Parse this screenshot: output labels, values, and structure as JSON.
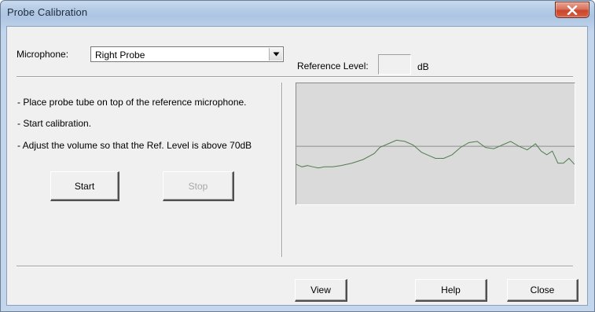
{
  "window": {
    "title": "Probe Calibration"
  },
  "microphone": {
    "label": "Microphone:",
    "selected": "Right Probe"
  },
  "instructions": [
    "- Place probe tube on top of the reference microphone.",
    "- Start calibration.",
    "- Adjust the volume so that the Ref. Level is above 70dB"
  ],
  "buttons": {
    "start": "Start",
    "stop": "Stop",
    "view": "View",
    "help": "Help",
    "close": "Close"
  },
  "reference": {
    "label": "Reference Level:",
    "value": "",
    "unit": "dB"
  },
  "colors": {
    "trace": "#4f7d4f",
    "reference_line": "#8e8e8e",
    "plot_background": "#dadada"
  },
  "chart_data": {
    "type": "line",
    "x": [
      0,
      0.02,
      0.04,
      0.06,
      0.08,
      0.1,
      0.13,
      0.16,
      0.2,
      0.24,
      0.28,
      0.3,
      0.33,
      0.36,
      0.39,
      0.42,
      0.45,
      0.48,
      0.5,
      0.53,
      0.56,
      0.59,
      0.62,
      0.65,
      0.68,
      0.71,
      0.74,
      0.77,
      0.8,
      0.83,
      0.86,
      0.88,
      0.9,
      0.92,
      0.94,
      0.96,
      0.98,
      1.0
    ],
    "series": [
      {
        "values": [
          0.33,
          0.31,
          0.32,
          0.31,
          0.3,
          0.31,
          0.31,
          0.32,
          0.34,
          0.37,
          0.42,
          0.47,
          0.5,
          0.53,
          0.52,
          0.49,
          0.43,
          0.4,
          0.38,
          0.38,
          0.41,
          0.47,
          0.51,
          0.52,
          0.47,
          0.46,
          0.49,
          0.52,
          0.48,
          0.45,
          0.5,
          0.44,
          0.41,
          0.44,
          0.34,
          0.34,
          0.38,
          0.33
        ]
      }
    ],
    "reference_level": 0.48,
    "xlim": [
      0,
      1
    ],
    "ylim": [
      0,
      1
    ],
    "grid": false
  }
}
